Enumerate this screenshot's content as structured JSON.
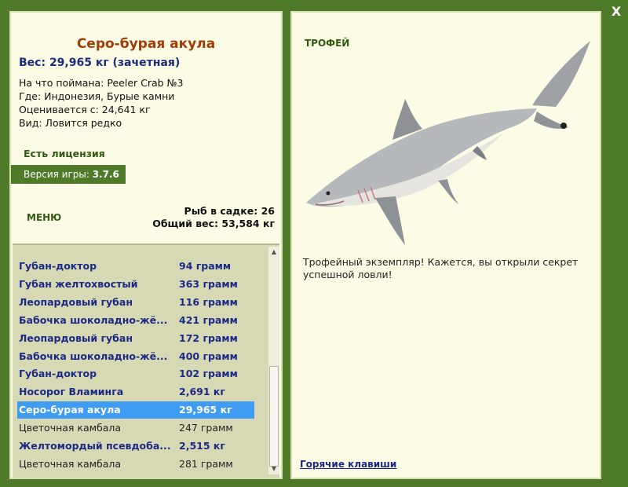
{
  "fish": {
    "name": "Серо-бурая акула",
    "weight_line": "Вес: 29,965 кг (зачетная)",
    "bait": "На что поймана: Peeler Crab №3",
    "location": "Где: Индонезия, Бурые камни",
    "value": "Оценивается с: 24,641 кг",
    "rarity": "Вид: Ловится редко"
  },
  "license": "Есть лицензия",
  "version": {
    "label": "Версия игры:",
    "value": "3.7.6"
  },
  "menu_label": "МЕНЮ",
  "keepnet": {
    "count_line": "Рыб в садке: 26",
    "total_line": "Общий вес: 53,584 кг"
  },
  "catch_list": [
    {
      "name": "Губан-доктор",
      "weight": "94 грамм",
      "style": "bold"
    },
    {
      "name": "Губан желтохвостый",
      "weight": "363 грамм",
      "style": "bold"
    },
    {
      "name": "Леопардовый губан",
      "weight": "116 грамм",
      "style": "bold"
    },
    {
      "name": "Бабочка шоколадно-жё...",
      "weight": "421 грамм",
      "style": "bold"
    },
    {
      "name": "Леопардовый губан",
      "weight": "172 грамм",
      "style": "bold"
    },
    {
      "name": "Бабочка шоколадно-жё...",
      "weight": "400 грамм",
      "style": "bold"
    },
    {
      "name": "Губан-доктор",
      "weight": "102 грамм",
      "style": "bold"
    },
    {
      "name": "Носорог Вламинга",
      "weight": "2,691 кг",
      "style": "bold"
    },
    {
      "name": "Серо-бурая акула",
      "weight": "29,965 кг",
      "style": "selected"
    },
    {
      "name": "Цветочная камбала",
      "weight": "247 грамм",
      "style": "plain"
    },
    {
      "name": "Желтомордый псевдоба...",
      "weight": "2,515 кг",
      "style": "bold"
    },
    {
      "name": "Цветочная камбала",
      "weight": "281 грамм",
      "style": "plain"
    }
  ],
  "trophy_label": "ТРОФЕЙ",
  "trophy_text": "Трофейный экземпляр! Кажется, вы открыли секрет успешной ловли!",
  "hotkeys_label": "Горячие клавиши",
  "close_label": "X",
  "icons": {
    "up": "scroll-up-icon",
    "down": "scroll-down-icon",
    "close": "close-icon"
  },
  "colors": {
    "frame": "#4e7a2a",
    "panel": "#fbfbe6",
    "selection": "#3f9cf2",
    "title": "#a43c06",
    "list_text": "#1b2a86"
  }
}
